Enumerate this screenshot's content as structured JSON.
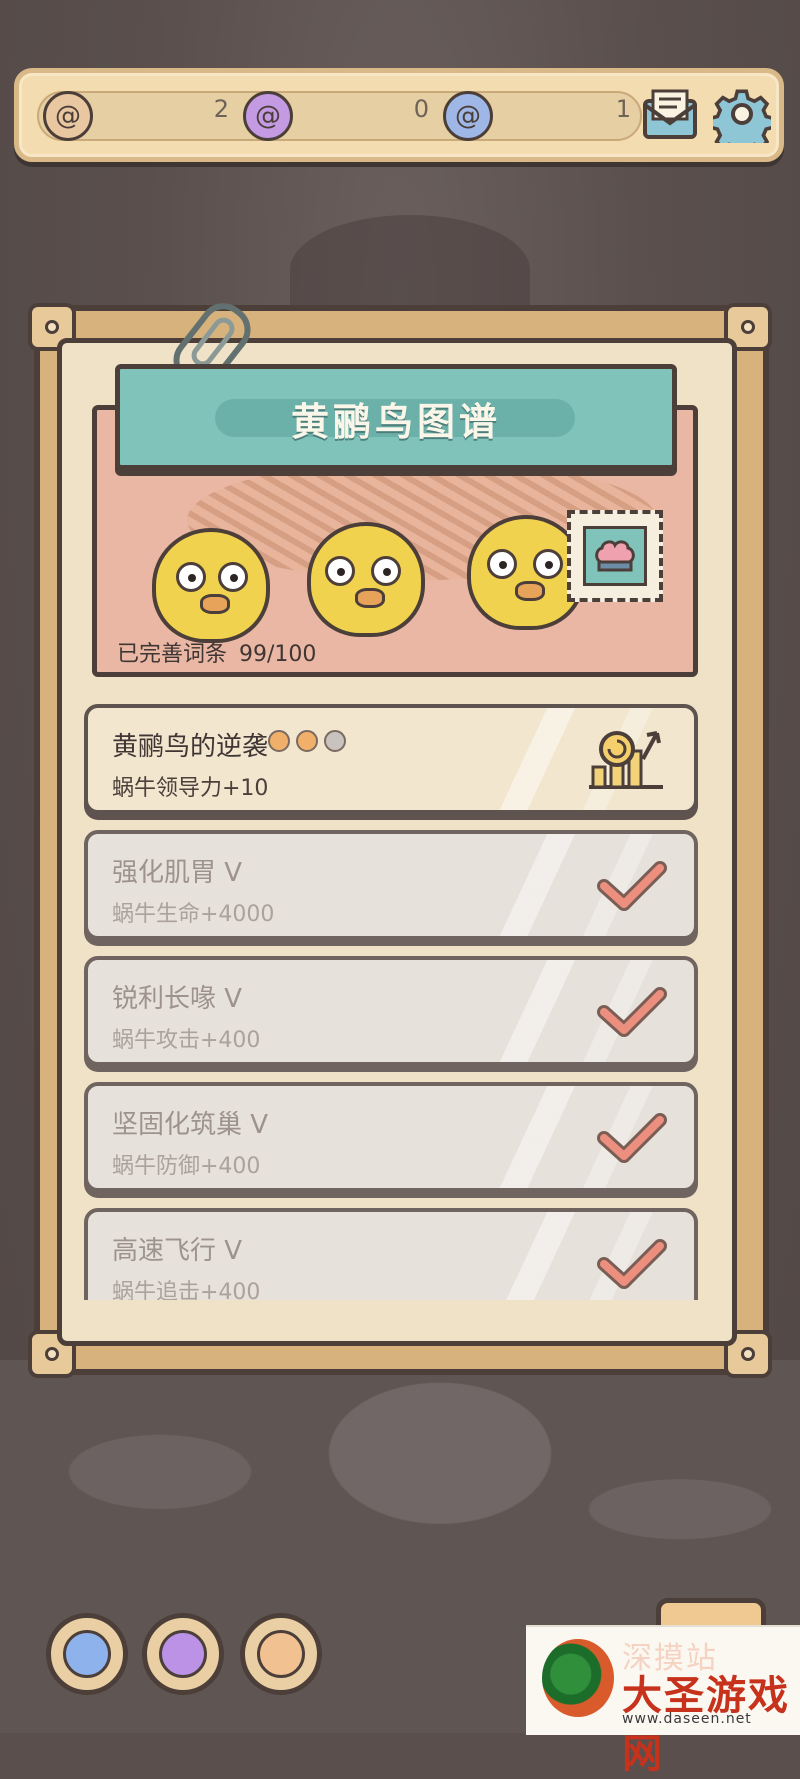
{
  "currency": [
    {
      "icon": "orange-snail-shell-icon",
      "value": "2"
    },
    {
      "icon": "purple-snail-shell-icon",
      "value": "0"
    },
    {
      "icon": "blue-snail-shell-icon",
      "value": "1"
    }
  ],
  "panel": {
    "title": "黄鹂鸟图谱",
    "progress_label": "已完善词条",
    "progress_value": "99/100"
  },
  "entries": [
    {
      "name": "黄鹂鸟的逆袭",
      "desc": "蜗牛领导力+10",
      "state": "upgrade",
      "dots_filled": 2,
      "dots_total": 3
    },
    {
      "name": "强化肌胃 V",
      "desc": "蜗牛生命+4000",
      "state": "completed"
    },
    {
      "name": "锐利长喙 V",
      "desc": "蜗牛攻击+400",
      "state": "completed"
    },
    {
      "name": "坚固化筑巢 V",
      "desc": "蜗牛防御+400",
      "state": "completed"
    },
    {
      "name": "高速飞行 V",
      "desc": "蜗牛追击+400",
      "state": "completed"
    }
  ],
  "colors": {
    "accent_teal": "#7fc3bb",
    "check_red": "#ec8f7e",
    "frame_dark": "#4c3f3a"
  },
  "watermark": {
    "title": "深摸站",
    "name": "大圣游戏网",
    "url": "www.daseen.net"
  }
}
